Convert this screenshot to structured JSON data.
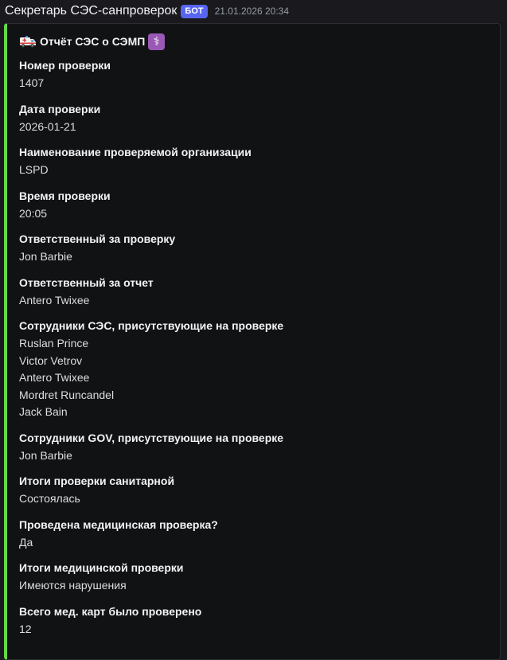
{
  "message": {
    "author": "Секретарь СЭС-санпроверок",
    "bot_tag": "БОТ",
    "timestamp": "21.01.2026 20:34"
  },
  "embed": {
    "accent_color": "#63d84a",
    "title": "Отчёт СЭС о СЭМП",
    "title_icons": [
      "ambulance-icon",
      "medical-staff-icon"
    ],
    "fields": [
      {
        "name": "Номер проверки",
        "value": "1407"
      },
      {
        "name": "Дата проверки",
        "value": "2026-01-21"
      },
      {
        "name": "Наименование проверяемой организации",
        "value": "LSPD"
      },
      {
        "name": "Время проверки",
        "value": "20:05"
      },
      {
        "name": "Ответственный за проверку",
        "value": "Jon Barbie"
      },
      {
        "name": "Ответственный за отчет",
        "value": "Antero Twixee"
      },
      {
        "name": "Сотрудники СЭС, присутствующие на проверке",
        "values": [
          "Ruslan Prince",
          "Victor Vetrov",
          "Antero Twixee",
          "Mordret Runcandel",
          "Jack Bain"
        ]
      },
      {
        "name": "Сотрудники GOV, присутствующие на проверке",
        "value": "Jon Barbie"
      },
      {
        "name": "Итоги проверки санитарной",
        "value": "Состоялась"
      },
      {
        "name": "Проведена медицинская проверка?",
        "value": "Да"
      },
      {
        "name": "Итоги медицинской проверки",
        "value": "Имеются нарушения"
      },
      {
        "name": "Всего мед. карт было проверено",
        "value": "12"
      }
    ]
  }
}
